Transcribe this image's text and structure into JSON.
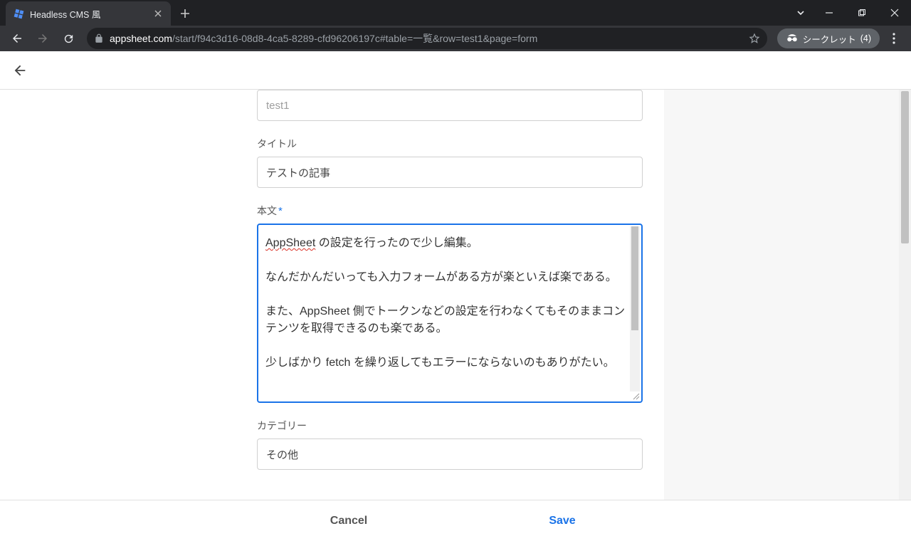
{
  "browser": {
    "tab_title": "Headless CMS 風",
    "url_host": "appsheet.com",
    "url_path": "/start/f94c3d16-08d8-4ca5-8289-cfd96206197c#table=一覧&row=test1&page=form",
    "incognito_label": "シークレット",
    "incognito_count": "(4)"
  },
  "form": {
    "id_field": {
      "value": "test1"
    },
    "title_field": {
      "label": "タイトル",
      "value": "テストの記事"
    },
    "body_field": {
      "label": "本文",
      "required_mark": "*",
      "spell_word": "AppSheet",
      "line1_rest": " の設定を行ったので少し編集。",
      "para2": "なんだかんだいっても入力フォームがある方が楽といえば楽である。",
      "para3": "また、AppSheet 側でトークンなどの設定を行わなくてもそのままコンテンツを取得できるのも楽である。",
      "para4": "少しばかり fetch を繰り返してもエラーにならないのもありがたい。"
    },
    "category_field": {
      "label": "カテゴリー",
      "value": "その他"
    }
  },
  "footer": {
    "cancel": "Cancel",
    "save": "Save"
  }
}
